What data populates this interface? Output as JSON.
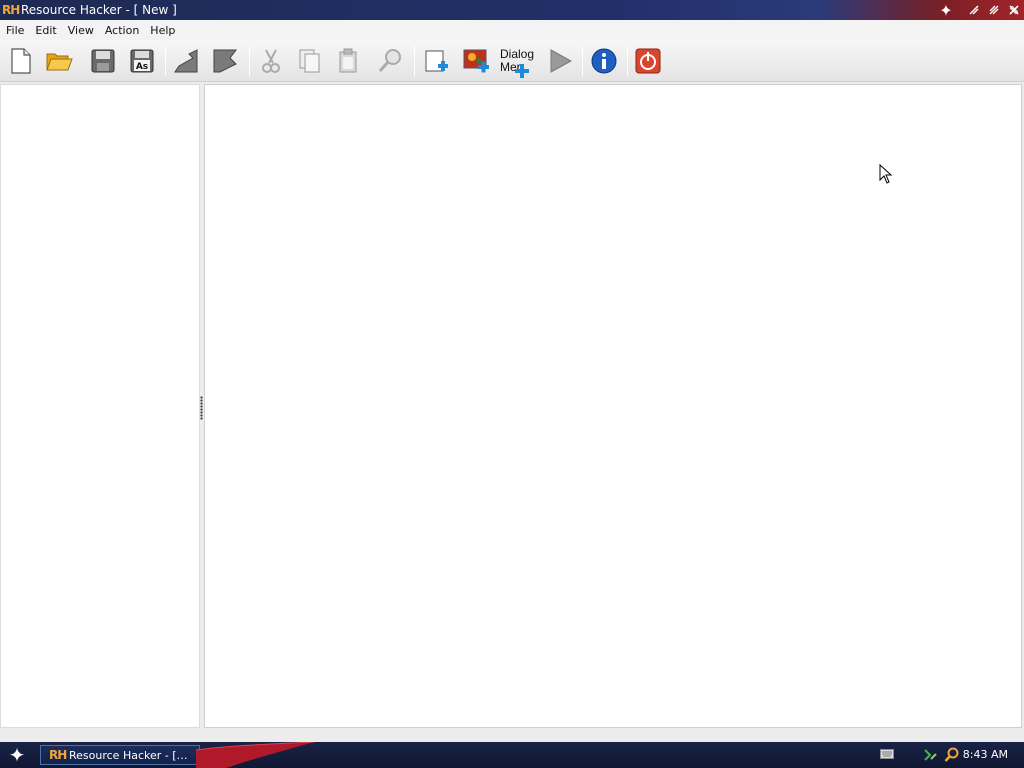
{
  "window": {
    "logo_text": "RH",
    "title": "Resource Hacker - [ New ]"
  },
  "menu": {
    "items": [
      "File",
      "Edit",
      "View",
      "Action",
      "Help"
    ]
  },
  "toolbar": {
    "buttons": [
      {
        "name": "new-file-icon"
      },
      {
        "name": "open-folder-icon"
      },
      {
        "name": "save-icon"
      },
      {
        "name": "save-as-icon",
        "label": "As"
      },
      {
        "name": "compile-back-icon"
      },
      {
        "name": "compile-forward-icon"
      },
      {
        "name": "cut-icon"
      },
      {
        "name": "copy-icon"
      },
      {
        "name": "paste-icon"
      },
      {
        "name": "find-icon"
      },
      {
        "name": "add-resource-icon"
      },
      {
        "name": "add-image-resource-icon"
      },
      {
        "name": "dialog-menu-icon"
      },
      {
        "name": "run-script-icon"
      },
      {
        "name": "about-icon"
      },
      {
        "name": "exit-icon"
      }
    ],
    "dialog_label_line1": "Dialog",
    "dialog_label_line2": "Mer"
  },
  "taskbar": {
    "task_logo": "RH",
    "task_label": "Resource Hacker - […",
    "clock": "8:43 AM"
  },
  "colors": {
    "title_bar": "#1e2a52",
    "accent_orange": "#f2a33a",
    "taskbar": "#13224a",
    "exit_red": "#d9452e",
    "info_blue": "#1f5fc0"
  }
}
